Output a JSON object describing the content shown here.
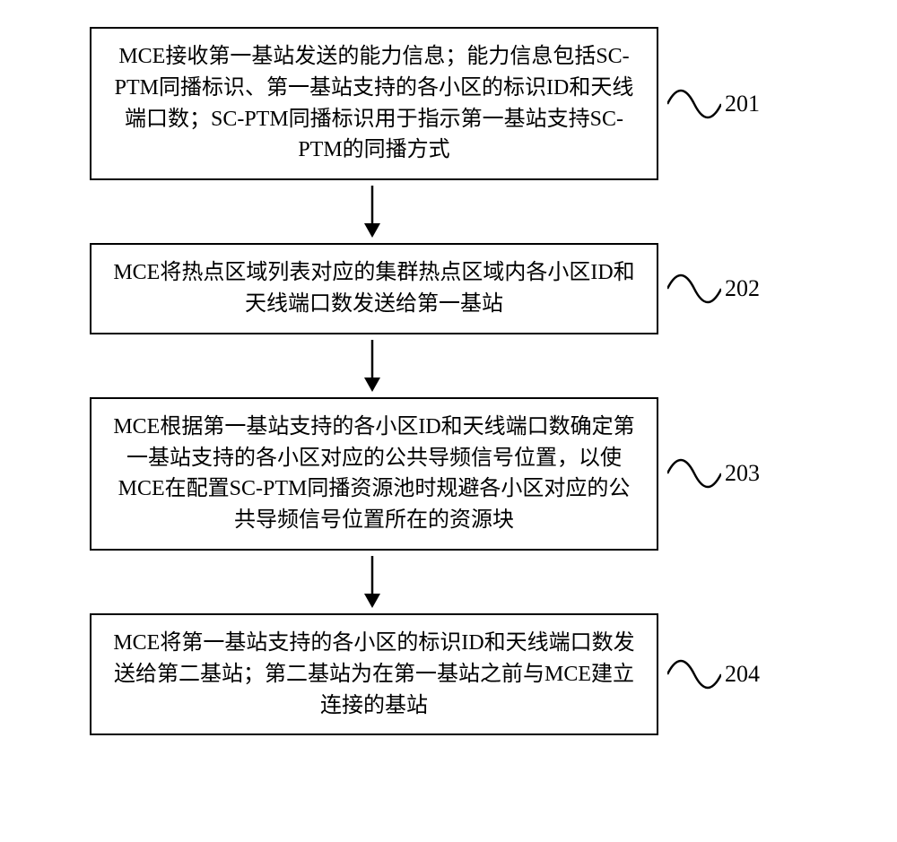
{
  "steps": [
    {
      "num": "201",
      "text": "MCE接收第一基站发送的能力信息；能力信息包括SC-PTM同播标识、第一基站支持的各小区的标识ID和天线端口数；SC-PTM同播标识用于指示第一基站支持SC-PTM的同播方式"
    },
    {
      "num": "202",
      "text": "MCE将热点区域列表对应的集群热点区域内各小区ID和天线端口数发送给第一基站"
    },
    {
      "num": "203",
      "text": "MCE根据第一基站支持的各小区ID和天线端口数确定第一基站支持的各小区对应的公共导频信号位置，以使MCE在配置SC-PTM同播资源池时规避各小区对应的公共导频信号位置所在的资源块"
    },
    {
      "num": "204",
      "text": "MCE将第一基站支持的各小区的标识ID和天线端口数发送给第二基站；第二基站为在第一基站之前与MCE建立连接的基站"
    }
  ]
}
